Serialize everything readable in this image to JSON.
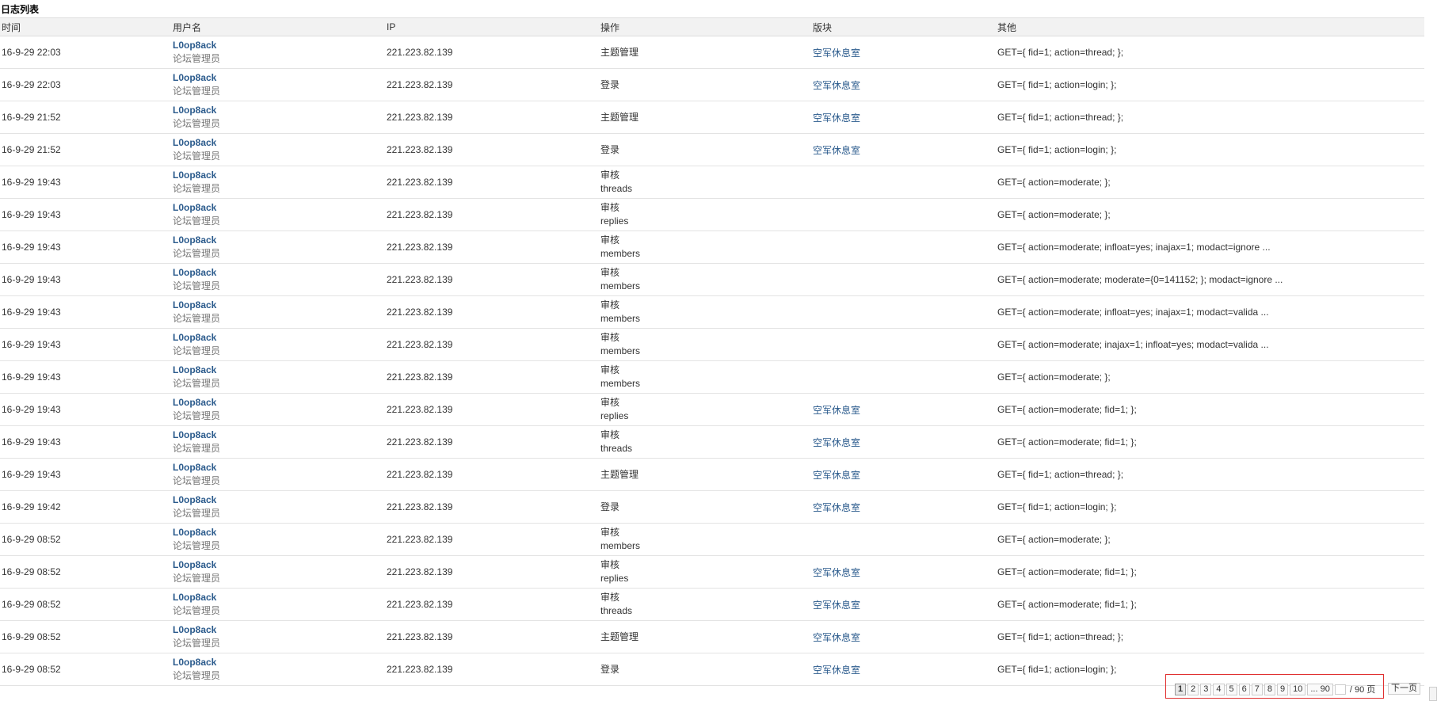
{
  "page_title": "日志列表",
  "columns": [
    "时间",
    "用户名",
    "IP",
    "操作",
    "版块",
    "其他"
  ],
  "rows": [
    {
      "time": "16-9-29 22:03",
      "user": "L0op8ack",
      "role": "论坛管理员",
      "ip": "221.223.82.139",
      "op": "主题管理",
      "op_sub": "",
      "forum": "空军休息室",
      "other": "GET={ fid=1; action=thread; };"
    },
    {
      "time": "16-9-29 22:03",
      "user": "L0op8ack",
      "role": "论坛管理员",
      "ip": "221.223.82.139",
      "op": "登录",
      "op_sub": "",
      "forum": "空军休息室",
      "other": "GET={ fid=1; action=login; };"
    },
    {
      "time": "16-9-29 21:52",
      "user": "L0op8ack",
      "role": "论坛管理员",
      "ip": "221.223.82.139",
      "op": "主题管理",
      "op_sub": "",
      "forum": "空军休息室",
      "other": "GET={ fid=1; action=thread; };"
    },
    {
      "time": "16-9-29 21:52",
      "user": "L0op8ack",
      "role": "论坛管理员",
      "ip": "221.223.82.139",
      "op": "登录",
      "op_sub": "",
      "forum": "空军休息室",
      "other": "GET={ fid=1; action=login; };"
    },
    {
      "time": "16-9-29 19:43",
      "user": "L0op8ack",
      "role": "论坛管理员",
      "ip": "221.223.82.139",
      "op": "审核",
      "op_sub": "threads",
      "forum": "",
      "other": "GET={ action=moderate; };"
    },
    {
      "time": "16-9-29 19:43",
      "user": "L0op8ack",
      "role": "论坛管理员",
      "ip": "221.223.82.139",
      "op": "审核",
      "op_sub": "replies",
      "forum": "",
      "other": "GET={ action=moderate; };"
    },
    {
      "time": "16-9-29 19:43",
      "user": "L0op8ack",
      "role": "论坛管理员",
      "ip": "221.223.82.139",
      "op": "审核",
      "op_sub": "members",
      "forum": "",
      "other": "GET={ action=moderate; infloat=yes; inajax=1; modact=ignore ..."
    },
    {
      "time": "16-9-29 19:43",
      "user": "L0op8ack",
      "role": "论坛管理员",
      "ip": "221.223.82.139",
      "op": "审核",
      "op_sub": "members",
      "forum": "",
      "other": "GET={ action=moderate; moderate={0=141152; }; modact=ignore ..."
    },
    {
      "time": "16-9-29 19:43",
      "user": "L0op8ack",
      "role": "论坛管理员",
      "ip": "221.223.82.139",
      "op": "审核",
      "op_sub": "members",
      "forum": "",
      "other": "GET={ action=moderate; infloat=yes; inajax=1; modact=valida ..."
    },
    {
      "time": "16-9-29 19:43",
      "user": "L0op8ack",
      "role": "论坛管理员",
      "ip": "221.223.82.139",
      "op": "审核",
      "op_sub": "members",
      "forum": "",
      "other": "GET={ action=moderate; inajax=1; infloat=yes; modact=valida ..."
    },
    {
      "time": "16-9-29 19:43",
      "user": "L0op8ack",
      "role": "论坛管理员",
      "ip": "221.223.82.139",
      "op": "审核",
      "op_sub": "members",
      "forum": "",
      "other": "GET={ action=moderate; };"
    },
    {
      "time": "16-9-29 19:43",
      "user": "L0op8ack",
      "role": "论坛管理员",
      "ip": "221.223.82.139",
      "op": "审核",
      "op_sub": "replies",
      "forum": "空军休息室",
      "other": "GET={ action=moderate; fid=1; };"
    },
    {
      "time": "16-9-29 19:43",
      "user": "L0op8ack",
      "role": "论坛管理员",
      "ip": "221.223.82.139",
      "op": "审核",
      "op_sub": "threads",
      "forum": "空军休息室",
      "other": "GET={ action=moderate; fid=1; };"
    },
    {
      "time": "16-9-29 19:43",
      "user": "L0op8ack",
      "role": "论坛管理员",
      "ip": "221.223.82.139",
      "op": "主题管理",
      "op_sub": "",
      "forum": "空军休息室",
      "other": "GET={ fid=1; action=thread; };"
    },
    {
      "time": "16-9-29 19:42",
      "user": "L0op8ack",
      "role": "论坛管理员",
      "ip": "221.223.82.139",
      "op": "登录",
      "op_sub": "",
      "forum": "空军休息室",
      "other": "GET={ fid=1; action=login; };"
    },
    {
      "time": "16-9-29 08:52",
      "user": "L0op8ack",
      "role": "论坛管理员",
      "ip": "221.223.82.139",
      "op": "审核",
      "op_sub": "members",
      "forum": "",
      "other": "GET={ action=moderate; };"
    },
    {
      "time": "16-9-29 08:52",
      "user": "L0op8ack",
      "role": "论坛管理员",
      "ip": "221.223.82.139",
      "op": "审核",
      "op_sub": "replies",
      "forum": "空军休息室",
      "other": "GET={ action=moderate; fid=1; };"
    },
    {
      "time": "16-9-29 08:52",
      "user": "L0op8ack",
      "role": "论坛管理员",
      "ip": "221.223.82.139",
      "op": "审核",
      "op_sub": "threads",
      "forum": "空军休息室",
      "other": "GET={ action=moderate; fid=1; };"
    },
    {
      "time": "16-9-29 08:52",
      "user": "L0op8ack",
      "role": "论坛管理员",
      "ip": "221.223.82.139",
      "op": "主题管理",
      "op_sub": "",
      "forum": "空军休息室",
      "other": "GET={ fid=1; action=thread; };"
    },
    {
      "time": "16-9-29 08:52",
      "user": "L0op8ack",
      "role": "论坛管理员",
      "ip": "221.223.82.139",
      "op": "登录",
      "op_sub": "",
      "forum": "空军休息室",
      "other": "GET={ fid=1; action=login; };"
    }
  ],
  "pagination": {
    "pages": [
      "1",
      "2",
      "3",
      "4",
      "5",
      "6",
      "7",
      "8",
      "9",
      "10"
    ],
    "current": "1",
    "ellipsis_last": "... 90",
    "total_text": "/ 90 页",
    "next": "下一页"
  },
  "colors": {
    "link": "#2a5a8c",
    "highlight_box": "#e03030"
  }
}
